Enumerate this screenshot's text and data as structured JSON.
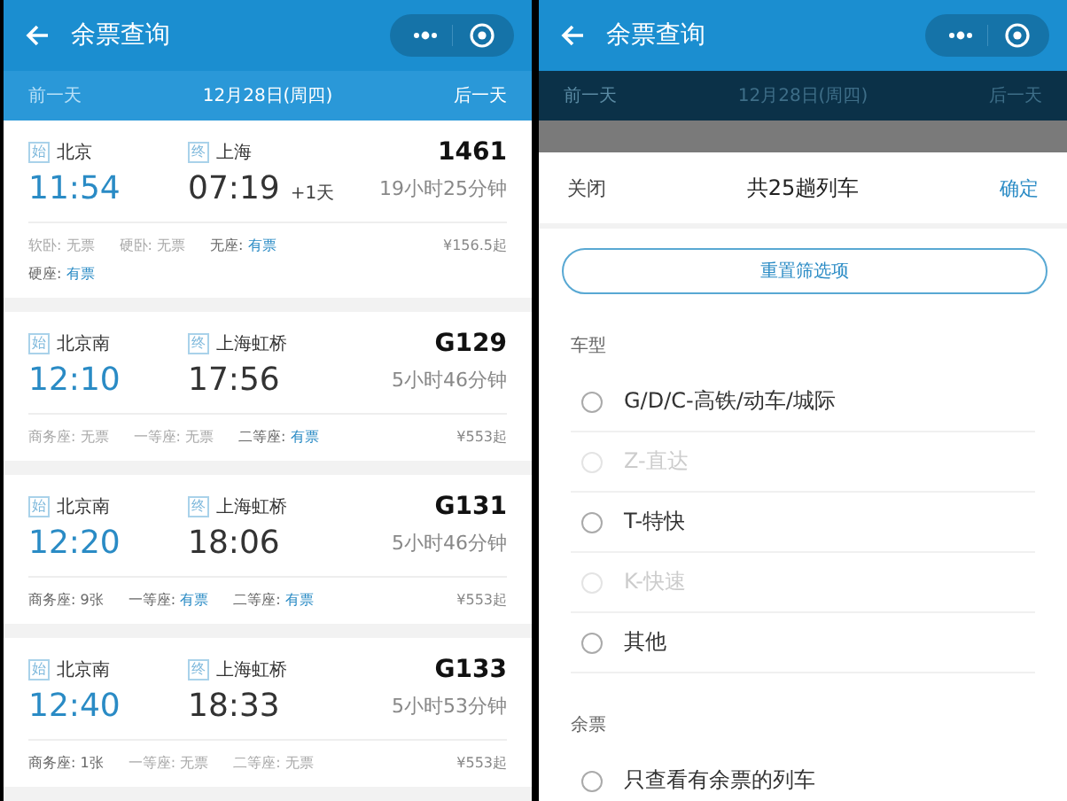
{
  "screens": [
    {
      "kind": "list",
      "header": {
        "title": "余票查询"
      },
      "date_bar": {
        "prev": {
          "label": "前一天",
          "disabled": true
        },
        "date": "12月28日(周四)",
        "next": {
          "label": "后一天",
          "disabled": false
        }
      },
      "trains": [
        {
          "from_tag": "始",
          "from": "北京",
          "to_tag": "终",
          "to": "上海",
          "number": "1461",
          "depart": "11:54",
          "arrive": "07:19",
          "next_day": "+1天",
          "duration": "19小时25分钟",
          "price": "¥156.5起",
          "seats": [
            {
              "label": "软卧:",
              "value": "无票",
              "kind": "none"
            },
            {
              "label": "硬卧:",
              "value": "无票",
              "kind": "none"
            },
            {
              "label": "无座:",
              "value": "有票",
              "kind": "available"
            },
            {
              "label": "硬座:",
              "value": "有票",
              "kind": "available"
            }
          ]
        },
        {
          "from_tag": "始",
          "from": "北京南",
          "to_tag": "终",
          "to": "上海虹桥",
          "number": "G129",
          "depart": "12:10",
          "arrive": "17:56",
          "duration": "5小时46分钟",
          "price": "¥553起",
          "seats": [
            {
              "label": "商务座:",
              "value": "无票",
              "kind": "none"
            },
            {
              "label": "一等座:",
              "value": "无票",
              "kind": "none"
            },
            {
              "label": "二等座:",
              "value": "有票",
              "kind": "available"
            }
          ]
        },
        {
          "from_tag": "始",
          "from": "北京南",
          "to_tag": "终",
          "to": "上海虹桥",
          "number": "G131",
          "depart": "12:20",
          "arrive": "18:06",
          "duration": "5小时46分钟",
          "price": "¥553起",
          "seats": [
            {
              "label": "商务座:",
              "value": "9张",
              "kind": "count"
            },
            {
              "label": "一等座:",
              "value": "有票",
              "kind": "available"
            },
            {
              "label": "二等座:",
              "value": "有票",
              "kind": "available"
            }
          ]
        },
        {
          "from_tag": "始",
          "from": "北京南",
          "to_tag": "终",
          "to": "上海虹桥",
          "number": "G133",
          "depart": "12:40",
          "arrive": "18:33",
          "duration": "5小时53分钟",
          "price": "¥553起",
          "seats": [
            {
              "label": "商务座:",
              "value": "1张",
              "kind": "count"
            },
            {
              "label": "一等座:",
              "value": "无票",
              "kind": "none"
            },
            {
              "label": "二等座:",
              "value": "无票",
              "kind": "none"
            }
          ]
        }
      ]
    },
    {
      "kind": "filter",
      "header": {
        "title": "余票查询"
      },
      "date_bar": {
        "prev": {
          "label": "前一天",
          "disabled": true
        },
        "date": "12月28日(周四)",
        "next": {
          "label": "后一天",
          "disabled": false
        }
      },
      "sheet": {
        "close": "关闭",
        "title": "共25趟列车",
        "confirm": "确定",
        "reset": "重置筛选项",
        "sections": [
          {
            "title": "车型",
            "options": [
              {
                "label": "G/D/C-高铁/动车/城际",
                "checked": false,
                "disabled": false
              },
              {
                "label": "Z-直达",
                "checked": false,
                "disabled": true
              },
              {
                "label": "T-特快",
                "checked": false,
                "disabled": false
              },
              {
                "label": "K-快速",
                "checked": false,
                "disabled": true
              },
              {
                "label": "其他",
                "checked": false,
                "disabled": false
              }
            ]
          },
          {
            "title": "余票",
            "options": [
              {
                "label": "只查看有余票的列车",
                "checked": false,
                "disabled": false
              }
            ]
          }
        ]
      }
    }
  ]
}
